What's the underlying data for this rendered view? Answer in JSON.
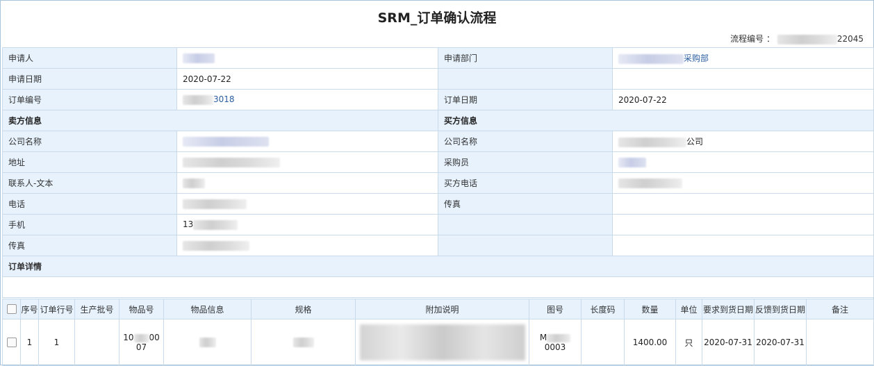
{
  "page": {
    "title": "SRM_订单确认流程",
    "flow_number_label": "流程编号 ：",
    "flow_number_suffix": "22045"
  },
  "info": {
    "applicant_label": "申请人",
    "apply_dept_label": "申请部门",
    "apply_dept_value_suffix": "采购部",
    "apply_date_label": "申请日期",
    "apply_date_value": "2020-07-22",
    "order_no_label": "订单编号",
    "order_no_suffix": "3018",
    "order_date_label": "订单日期",
    "order_date_value": "2020-07-22",
    "seller_section": "卖方信息",
    "buyer_section": "买方信息",
    "seller_company_label": "公司名称",
    "buyer_company_label": "公司名称",
    "buyer_company_suffix": "公司",
    "address_label": "地址",
    "buyer_purchaser_label": "采购员",
    "contact_label": "联系人-文本",
    "buyer_phone_label": "买方电话",
    "phone_label": "电话",
    "buyer_fax_label": "传真",
    "mobile_label": "手机",
    "mobile_prefix": "13",
    "fax_label": "传真",
    "order_detail_label": "订单详情"
  },
  "items": {
    "headers": [
      "序号",
      "订单行号",
      "生产批号",
      "物品号",
      "物品信息",
      "规格",
      "附加说明",
      "图号",
      "长度码",
      "数量",
      "单位",
      "要求到货日期",
      "反馈到货日期",
      "备注"
    ],
    "rows": [
      {
        "seq": "1",
        "line_no": "1",
        "batch_no": "",
        "item_no_top": "10",
        "item_no_top_suffix": "00",
        "item_no_bottom": "07",
        "drawing_prefix": "M",
        "drawing_suffix": "0003",
        "length_code": "",
        "quantity": "1400.00",
        "unit": "只",
        "required_date": "2020-07-31",
        "feedback_date": "2020-07-31",
        "remark": ""
      }
    ]
  }
}
